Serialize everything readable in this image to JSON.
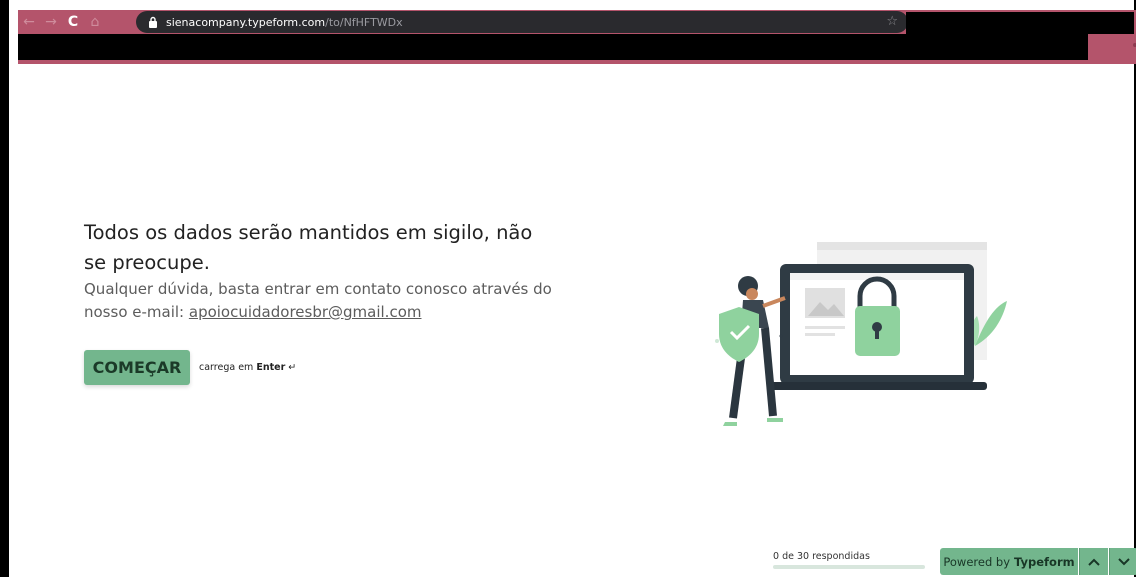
{
  "browser": {
    "back_icon": "arrow-left-icon",
    "forward_icon": "arrow-right-icon",
    "reload_icon": "reload-icon",
    "home_icon": "home-icon",
    "url_host": "sienacompany.typeform.com",
    "url_path": "/to/NfHFTWDx",
    "bookmark_icon": "star-icon",
    "theme_color": "#b4546b"
  },
  "form": {
    "title": "Todos os dados serão mantidos em sigilo, não se preocupe.",
    "description_prefix": "Qualquer dúvida, basta entrar em contato conosco através do nosso e-mail: ",
    "email": "apoiocuidadoresbr@gmail.com",
    "start_label": "COMEÇAR",
    "hint_prefix": "carrega em ",
    "hint_key": "Enter",
    "hint_icon": "↵",
    "accent_color": "#73b68d"
  },
  "footer": {
    "progress_text": "0 de 30 respondidas",
    "progress_fraction": 0,
    "powered_prefix": "Powered by",
    "powered_brand": "Typeform",
    "up_icon": "chevron-up-icon",
    "down_icon": "chevron-down-icon"
  }
}
